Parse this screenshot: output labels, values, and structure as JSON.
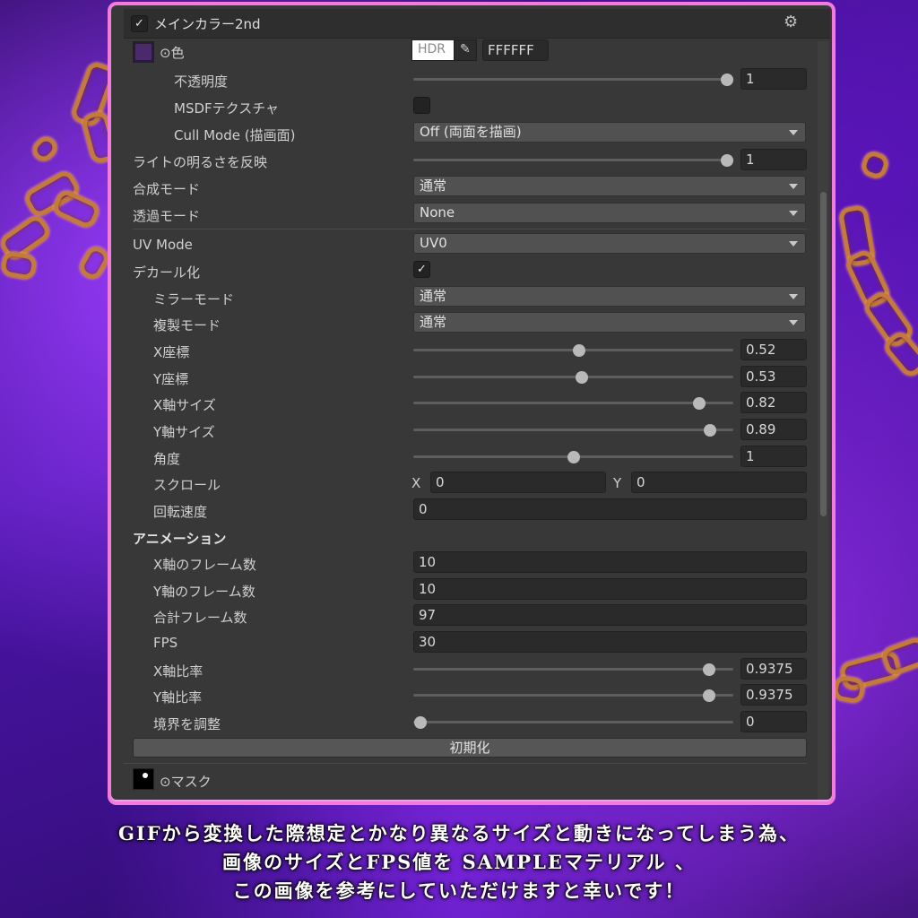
{
  "component": {
    "title": "メインカラー2nd",
    "enabled": true,
    "color_label": "⊙色",
    "hdr_label": "HDR",
    "color_hex": "FFFFFF"
  },
  "rows": {
    "opacity": {
      "label": "不透明度",
      "value": "1",
      "slider_fraction": 1.0
    },
    "msdf": {
      "label": "MSDFテクスチャ",
      "checked": false
    },
    "cull_mode": {
      "label": "Cull Mode (描画面)",
      "value": "Off (両面を描画)"
    },
    "light": {
      "label": "ライトの明るさを反映",
      "value": "1",
      "slider_fraction": 1.0
    },
    "blend_mode": {
      "label": "合成モード",
      "value": "通常"
    },
    "transparent_mode": {
      "label": "透過モード",
      "value": "None"
    },
    "uv_mode": {
      "label": "UV Mode",
      "value": "UV0"
    },
    "decal": {
      "label": "デカール化",
      "checked": true
    },
    "mirror_mode": {
      "label": "ミラーモード",
      "value": "通常"
    },
    "copy_mode": {
      "label": "複製モード",
      "value": "通常"
    },
    "x_pos": {
      "label": "X座標",
      "value": "0.52",
      "slider_fraction": 0.52
    },
    "y_pos": {
      "label": "Y座標",
      "value": "0.53",
      "slider_fraction": 0.53
    },
    "x_size": {
      "label": "X軸サイズ",
      "value": "0.82",
      "slider_fraction": 0.89
    },
    "y_size": {
      "label": "Y軸サイズ",
      "value": "0.89",
      "slider_fraction": 0.93
    },
    "angle": {
      "label": "角度",
      "value": "1",
      "slider_fraction": 0.5
    },
    "scroll": {
      "label": "スクロール",
      "x_label": "X",
      "x_value": "0",
      "y_label": "Y",
      "y_value": "0"
    },
    "rotation_speed": {
      "label": "回転速度",
      "value": "0"
    },
    "animation_header": "アニメーション",
    "x_frames": {
      "label": "X軸のフレーム数",
      "value": "10"
    },
    "y_frames": {
      "label": "Y軸のフレーム数",
      "value": "10"
    },
    "total_frames": {
      "label": "合計フレーム数",
      "value": "97"
    },
    "fps": {
      "label": "FPS",
      "value": "30"
    },
    "x_ratio": {
      "label": "X軸比率",
      "value": "0.9375",
      "slider_fraction": 0.9375
    },
    "y_ratio": {
      "label": "Y軸比率",
      "value": "0.9375",
      "slider_fraction": 0.9375
    },
    "border": {
      "label": "境界を調整",
      "value": "0",
      "slider_fraction": 0.0
    },
    "reset_button": "初期化",
    "mask_label": "⊙マスク"
  },
  "caption": {
    "line1": "GIFから変換した際想定とかなり異なるサイズと動きになってしまう為、",
    "line2": "画像のサイズとFPS値を SAMPLEマテリアル 、",
    "line3": "この画像を参考にしていただけますと幸いです！"
  },
  "colors": {
    "frame_border": "#f27bdc",
    "panel_bg": "#383838",
    "background": "#4b15a8"
  }
}
